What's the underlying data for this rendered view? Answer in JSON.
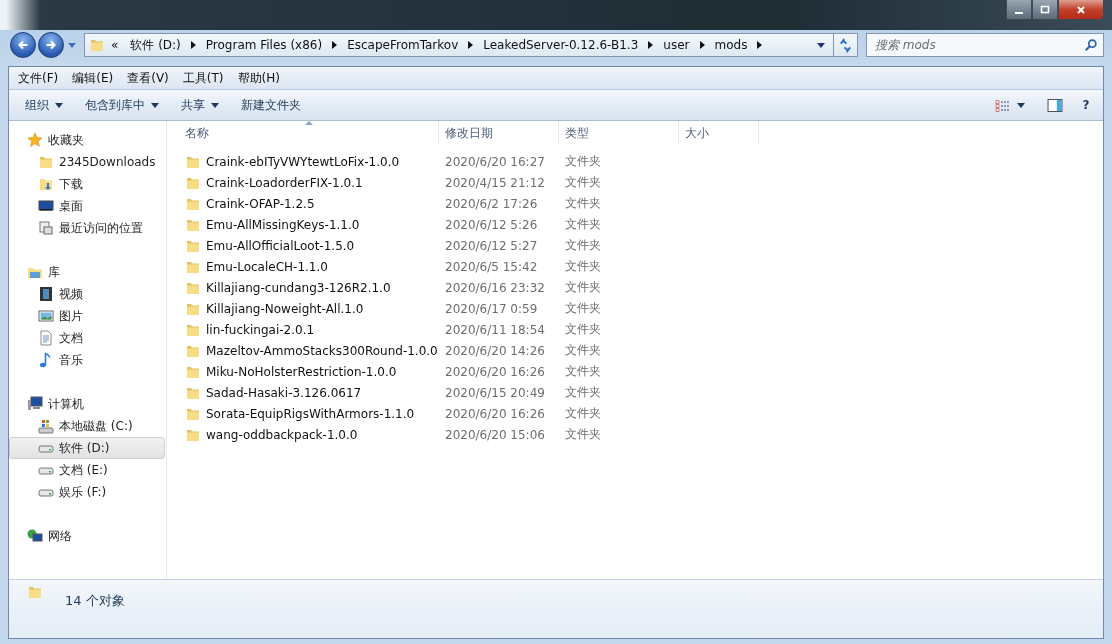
{
  "address": {
    "overflow": "«",
    "segments": [
      "软件 (D:)",
      "Program Files (x86)",
      "EscapeFromTarkov",
      "LeakedServer-0.12.6-B1.3",
      "user",
      "mods"
    ]
  },
  "search": {
    "placeholder": "搜索 mods"
  },
  "menu": [
    "文件(F)",
    "编辑(E)",
    "查看(V)",
    "工具(T)",
    "帮助(H)"
  ],
  "toolbar": [
    {
      "label": "组织",
      "dropdown": true
    },
    {
      "label": "包含到库中",
      "dropdown": true
    },
    {
      "label": "共享",
      "dropdown": true
    },
    {
      "label": "新建文件夹",
      "dropdown": false
    }
  ],
  "sidebar": [
    {
      "label": "收藏夹",
      "kind": "favorites",
      "children": [
        {
          "label": "2345Downloads",
          "kind": "folder",
          "selected": false
        },
        {
          "label": "下载",
          "kind": "downloads",
          "selected": false
        },
        {
          "label": "桌面",
          "kind": "desktop",
          "selected": false
        },
        {
          "label": "最近访问的位置",
          "kind": "recent",
          "selected": false
        }
      ]
    },
    {
      "label": "库",
      "kind": "library",
      "children": [
        {
          "label": "视频",
          "kind": "video",
          "selected": false
        },
        {
          "label": "图片",
          "kind": "picture",
          "selected": false
        },
        {
          "label": "文档",
          "kind": "document",
          "selected": false
        },
        {
          "label": "音乐",
          "kind": "music",
          "selected": false
        }
      ]
    },
    {
      "label": "计算机",
      "kind": "computer",
      "children": [
        {
          "label": "本地磁盘 (C:)",
          "kind": "system-drive",
          "selected": false
        },
        {
          "label": "软件 (D:)",
          "kind": "drive",
          "selected": true
        },
        {
          "label": "文档 (E:)",
          "kind": "drive",
          "selected": false
        },
        {
          "label": "娱乐 (F:)",
          "kind": "drive",
          "selected": false
        }
      ]
    },
    {
      "label": "网络",
      "kind": "network"
    }
  ],
  "help_button": "?",
  "table": {
    "columns": [
      {
        "label": "名称",
        "sorted": true
      },
      {
        "label": "修改日期",
        "sorted": false
      },
      {
        "label": "类型",
        "sorted": false
      },
      {
        "label": "大小",
        "sorted": false
      }
    ],
    "rows": [
      {
        "name": "Craink-ebITyVWYtewtLoFix-1.0.0",
        "date": "2020/6/20 16:27",
        "type": "文件夹"
      },
      {
        "name": "Craink-LoadorderFIX-1.0.1",
        "date": "2020/4/15 21:12",
        "type": "文件夹"
      },
      {
        "name": "Craink-OFAP-1.2.5",
        "date": "2020/6/2 17:26",
        "type": "文件夹"
      },
      {
        "name": "Emu-AllMissingKeys-1.1.0",
        "date": "2020/6/12 5:26",
        "type": "文件夹"
      },
      {
        "name": "Emu-AllOfficialLoot-1.5.0",
        "date": "2020/6/12 5:27",
        "type": "文件夹"
      },
      {
        "name": "Emu-LocaleCH-1.1.0",
        "date": "2020/6/5 15:42",
        "type": "文件夹"
      },
      {
        "name": "Killajiang-cundang3-126R2.1.0",
        "date": "2020/6/16 23:32",
        "type": "文件夹"
      },
      {
        "name": "Killajiang-Noweight-All.1.0",
        "date": "2020/6/17 0:59",
        "type": "文件夹"
      },
      {
        "name": "lin-fuckingai-2.0.1",
        "date": "2020/6/11 18:54",
        "type": "文件夹"
      },
      {
        "name": "Mazeltov-AmmoStacks300Round-1.0.0",
        "date": "2020/6/20 14:26",
        "type": "文件夹"
      },
      {
        "name": "Miku-NoHolsterRestriction-1.0.0",
        "date": "2020/6/20 16:26",
        "type": "文件夹"
      },
      {
        "name": "Sadad-Hasaki-3.126.0617",
        "date": "2020/6/15 20:49",
        "type": "文件夹"
      },
      {
        "name": "Sorata-EquipRigsWithArmors-1.1.0",
        "date": "2020/6/20 16:26",
        "type": "文件夹"
      },
      {
        "name": "wang-oddbackpack-1.0.0",
        "date": "2020/6/20 15:06",
        "type": "文件夹"
      }
    ]
  },
  "status_bar": {
    "count": "14 个对象"
  }
}
